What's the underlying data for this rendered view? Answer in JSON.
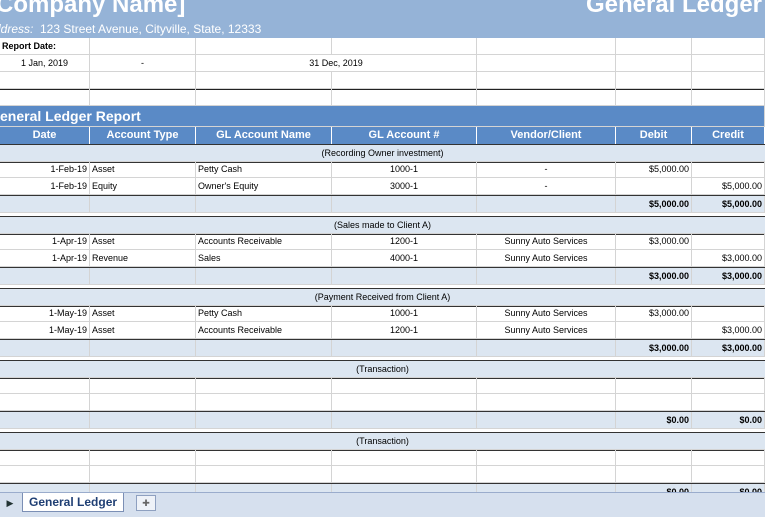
{
  "header": {
    "company": "Company Name]",
    "title": "General Ledger",
    "address_label": "ldress:",
    "address_value": "123 Street Avenue, Cityville, State, 12333"
  },
  "report": {
    "date_label": "Report Date:",
    "start": "1 Jan, 2019",
    "separator": "-",
    "end": "31 Dec, 2019",
    "section_title": "eneral Ledger Report"
  },
  "columns": [
    "Date",
    "Account Type",
    "GL Account Name",
    "GL Account #",
    "Vendor/Client",
    "Debit",
    "Credit"
  ],
  "groups": [
    {
      "label": "(Recording Owner investment)",
      "rows": [
        {
          "date": "1-Feb-19",
          "type": "Asset",
          "name": "Petty Cash",
          "num": "1000-1",
          "vendor": "-",
          "debit": "$5,000.00",
          "credit": ""
        },
        {
          "date": "1-Feb-19",
          "type": "Equity",
          "name": "Owner's Equity",
          "num": "3000-1",
          "vendor": "-",
          "debit": "",
          "credit": "$5,000.00"
        }
      ],
      "total_debit": "$5,000.00",
      "total_credit": "$5,000.00"
    },
    {
      "label": "(Sales made to Client A)",
      "rows": [
        {
          "date": "1-Apr-19",
          "type": "Asset",
          "name": "Accounts Receivable",
          "num": "1200-1",
          "vendor": "Sunny Auto Services",
          "debit": "$3,000.00",
          "credit": ""
        },
        {
          "date": "1-Apr-19",
          "type": "Revenue",
          "name": "Sales",
          "num": "4000-1",
          "vendor": "Sunny Auto Services",
          "debit": "",
          "credit": "$3,000.00"
        }
      ],
      "total_debit": "$3,000.00",
      "total_credit": "$3,000.00"
    },
    {
      "label": "(Payment Received from Client A)",
      "rows": [
        {
          "date": "1-May-19",
          "type": "Asset",
          "name": "Petty Cash",
          "num": "1000-1",
          "vendor": "Sunny Auto Services",
          "debit": "$3,000.00",
          "credit": ""
        },
        {
          "date": "1-May-19",
          "type": "Asset",
          "name": "Accounts Receivable",
          "num": "1200-1",
          "vendor": "Sunny Auto Services",
          "debit": "",
          "credit": "$3,000.00"
        }
      ],
      "total_debit": "$3,000.00",
      "total_credit": "$3,000.00"
    },
    {
      "label": "(Transaction)",
      "rows": [
        {
          "date": "",
          "type": "",
          "name": "",
          "num": "",
          "vendor": "",
          "debit": "",
          "credit": ""
        },
        {
          "date": "",
          "type": "",
          "name": "",
          "num": "",
          "vendor": "",
          "debit": "",
          "credit": ""
        }
      ],
      "total_debit": "$0.00",
      "total_credit": "$0.00"
    },
    {
      "label": "(Transaction)",
      "rows": [
        {
          "date": "",
          "type": "",
          "name": "",
          "num": "",
          "vendor": "",
          "debit": "",
          "credit": ""
        },
        {
          "date": "",
          "type": "",
          "name": "",
          "num": "",
          "vendor": "",
          "debit": "",
          "credit": ""
        }
      ],
      "total_debit": "$0.00",
      "total_credit": "$0.00"
    }
  ],
  "tabs": {
    "nav_icon": "triangle-right-icon",
    "active": "General Ledger",
    "new_icon": "new-sheet-icon"
  },
  "colors": {
    "banner": "#95b3d7",
    "header_blue": "#5a8ac6",
    "band_light": "#dce6f1"
  }
}
